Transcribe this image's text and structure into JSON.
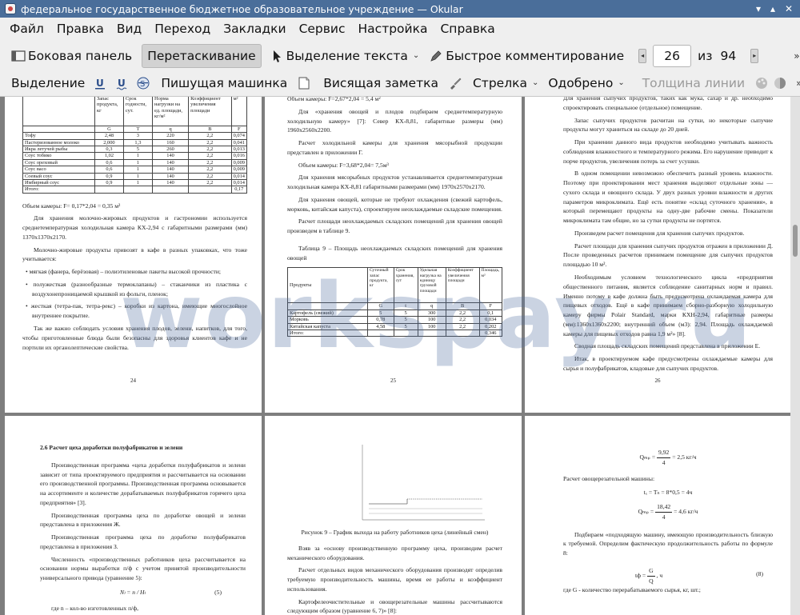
{
  "window": {
    "title": "федеральное государственное бюджетное образовательное учреждение  — Okular"
  },
  "menu": [
    "Файл",
    "Правка",
    "Вид",
    "Переход",
    "Закладки",
    "Сервис",
    "Настройка",
    "Справка"
  ],
  "toolbar1": {
    "sidebar": "Боковая панель",
    "drag": "Перетаскивание",
    "text_select": "Выделение текста",
    "quick_comment": "Быстрое комментирование",
    "page_current": "26",
    "page_of": "из",
    "page_total": "94"
  },
  "toolbar2": {
    "select": "Выделение",
    "typewriter": "Пишущая машинка",
    "sticky_note": "Висящая заметка",
    "arrow": "Стрелка",
    "approved": "Одобрено",
    "line_width": "Толщина линии"
  },
  "watermark": "workspay.ru",
  "pages": {
    "p24": {
      "table_header": [
        "Запас продукта, кг",
        "Срок годности, сут.",
        "Норма нагрузки на ед. площади, кг/м²",
        "Коэффициент увеличения площади",
        "м²"
      ],
      "table_letters": [
        "G",
        "T",
        "q",
        "B",
        "F"
      ],
      "rows": [
        [
          "Тофу",
          "2,48",
          "3",
          "220",
          "2,2",
          "0,074"
        ],
        [
          "Пастеризованное молоко",
          "2,000",
          "1,3",
          "160",
          "2,2",
          "0,041"
        ],
        [
          "Икра летучей рыбы",
          "0,3",
          "5",
          "260",
          "2,2",
          "0,013"
        ],
        [
          "Соус тобико",
          "1,02",
          "1",
          "140",
          "2,2",
          "0,016"
        ],
        [
          "Соус ореховый",
          "0,6",
          "1",
          "140",
          "2,2",
          "0,009"
        ],
        [
          "Соус васо",
          "0,6",
          "1",
          "140",
          "2,2",
          "0,009"
        ],
        [
          "Соевый соус",
          "0,9",
          "1",
          "140",
          "2,2",
          "0,014"
        ],
        [
          "Имбирный соус",
          "0,9",
          "1",
          "140",
          "2,2",
          "0,014"
        ],
        [
          "Итого:",
          "",
          "",
          "",
          "",
          "0,17"
        ]
      ],
      "area_line": "Объем камеры: F= 0,17*2,04 = 0,35 м²",
      "para1": "Для хранения молочно-жировых продуктов и гастрономии используется среднетемпературная холодильная камера КХ-2,94 с габаритными размерами (мм) 1370х1370х2170.",
      "para2": "Молочно-жировые продукты привозят в кафе в разных упаковках, что тоже учитывается:",
      "b1": "мягкая (фанера, берёзовая) – полиэтиленовые пакеты высокой прочности;",
      "b2": "полужесткая (разнообразные термоклапаны) – стаканчики из пластика с воздухонепроницаемой крышкой из фольги, пленок;",
      "b3": "жесткая (тетра-пак, тетра-рекс) – коробки из картона, имеющие многослойное внутреннее покрытие.",
      "para3": "Так же важно соблюдать условия хранения плодов, зелени, напитков, для того, чтобы приготовленные блюда были безопасны для здоровья клиентов кафе и не портили их органолептические свойства.",
      "num": "24"
    },
    "p25": {
      "top": "Объем камеры: F=2,67*2,04 = 5,4 м²",
      "para1": "Для «хранения овощей и плодов подбираем среднетемпературную холодильную камеру» [7]: Север КХ-8,81, габаритные размеры (мм) 1960х2560х2200.",
      "para2": "Расчет холодильной камеры для хранения мясорыбной продукции представлен в приложении Г.",
      "formula": "Объем камеры: F=3,68*2,04= 7,5м³",
      "para3": "Для хранения мясорыбных продуктов устанавливается среднетемпературная холодильная камера КХ-8,81 габаритными размерами (мм) 1970х2570х2170.",
      "para4": "Для хранения овощей, которые не требуют охлаждения (свежий картофель, морковь, китайская капуста), спроектируем неохлаждаемые складские помещения.",
      "para5": "Расчет площади неохлаждаемых складских помещений для хранения овощей произведем в таблице 9.",
      "caption": "Таблица 9 – Площадь неохлаждаемых складских помещений для хранения овощей",
      "table_header": [
        "Продукты",
        "Суточный запас продукта, кг",
        "Срок хранения, сут",
        "Удельная нагрузка на единицу грузовой площади",
        "Коэффициент увеличения площади",
        "Площадь, м²"
      ],
      "table_letters": [
        "",
        "G",
        "t",
        "q",
        "B",
        "F"
      ],
      "rows": [
        [
          "Картофель (свежий)",
          "5",
          "5",
          "300",
          "2,2",
          "0,1"
        ],
        [
          "Морковь",
          "0,78",
          "5",
          "100",
          "2,2",
          "0,034"
        ],
        [
          "Китайская капуста",
          "4,58",
          "5",
          "100",
          "2,2",
          "0,202"
        ],
        [
          "Итого:",
          "",
          "",
          "",
          "",
          "0,346"
        ]
      ],
      "num": "25"
    },
    "p26": {
      "top": "Для хранения сыпучих продуктов, таких как мука, сахар и др. необходимо спроектировать специальное (отдельное) помещение.",
      "para1": "Запас сыпучих продуктов расчитан на сутки, но некоторые сыпучие продукты могут храниться на складе до 20 дней.",
      "para2": "При хранении данного вида продуктов необходимо учитывать важность соблюдения влажностного и температурного режима. Его нарушение приводит к порче продуктов, увеличения потерь за счет усушки.",
      "para3": "В одном помещении невозможно обеспечить разный уровень влажности. Поэтому при проектировании мест хранения выделяют отдельные зоны — сухого склада и овощного склада. У двух разных уровни влажности и других параметров микроклимата. Ещё есть понятие «склад суточного хранения», в который перемещают продукты на одну-две рабочие смены. Показатели микроклимата там общие, но за сутки продукты не портятся.",
      "para4": "Произведем расчет помещения для хранения сыпучих продуктов.",
      "para5": "Расчет площади для хранения сыпучих продуктов отражен в приложении Д. После проведенных расчетов принимаем помещение для сыпучих продуктов площадью 10 м².",
      "para6": "Необходимым условием технологического цикла «предприятия общественного питания, является соблюдение санитарных норм и правил. Именно потому в кафе должна быть предусмотрена охлаждаемая камера для пищевых отходов. Ещё в кафе принимаем сборно-разборную холодильную камеру фирмы Polair Standard, марки КХН-2,94, габаритные размеры (мм):1360х1360х2200; внутренний объем (м3): 2,94. Площадь охлаждаемой камеры для пищевых отходов равна 1,9 м²» [8].",
      "para7": "Сводная площадь складских помещений представлена в приложении Е.",
      "para8": "Итак, в проектируемом кафе предусмотрены охлаждаемые камеры для сырья и полуфабрикатов, кладовые для сыпучих продуктов.",
      "num": "26"
    },
    "p27": {
      "heading": "2.6 Расчет цеха доработки полуфабрикатов и зелени",
      "para1": "Производственная программа «цеха доработки полуфабрикатов и зелени зависит от типа проектируемого предприятия и рассчитывается на основании его производственной программы. Производственная программа основывается на ассортименте и количестве дорабатываемых полуфабрикатов горячего цеха предприятия» [3].",
      "para2": "Производственная программа цеха по доработке овощей и зелени представлена в приложения Ж.",
      "para3": "Производственная программа цеха по доработке полуфабрикатов представлена в приложения З.",
      "para4": "Численность «производственных работников цеха рассчитывается на основании нормы выработки п/ф с учетом принятой производительности универсального привода (уравнение 5):",
      "formula": "Nₗ = n / Hₗ",
      "eq": "(5)",
      "bottom": "где n – кол-во изготовленных п/ф,"
    },
    "p28": {
      "figure_caption": "Рисунок 9 – График выхода на работу работников цеха (линейный смен)",
      "para1": "Взяв за «основу производственную программу цеха, производим расчет механического оборудования.",
      "para2": "Расчет отдельных видов механического оборудования производят определив требуемую производительность машины, время ее работы и коэффициент использования.",
      "para3": "Картофелеочистительные и овощерезательные машины рассчитываются следующим образом (уравнение 6, 7)» [8]:"
    },
    "p29": {
      "f1_lhs": "Qₘₚ =",
      "f1_num": "9,92",
      "f1_den": "4",
      "f1_rhs": "= 2,5 кг/ч",
      "line1": "Расчет овощерезательной машины:",
      "f2": "tₓ = Tₙ = 8*0,5 = 4ч",
      "f3_lhs": "Qₘₚ =",
      "f3_num": "18,42",
      "f3_den": "4",
      "f3_rhs": "= 4,6 кг/ч",
      "para1": "Подбираем «подходящую машину, имеющую производительность близкую к требуемой. Определим фактическую продолжительность работы по формуле 8:",
      "f4_lhs": "tф =",
      "f4_num": "G",
      "f4_den": "Q",
      "f4_rhs": ", ч",
      "eq": "(8)",
      "bottom": "где G - количество перерабатываемого сырья, кг, шт.;"
    }
  }
}
